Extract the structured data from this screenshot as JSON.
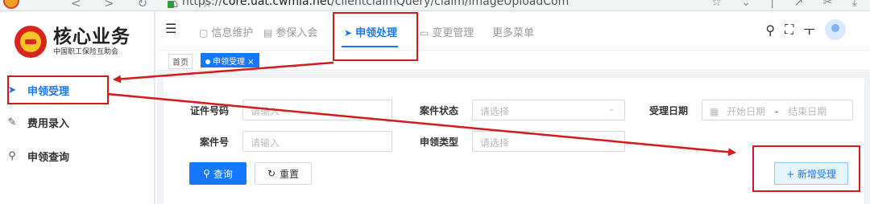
{
  "browser": {
    "url_prefix": "https://",
    "url_host": "core.uat.cwmia.net",
    "url_path": "/clientclaimQuery/claim/imageUploadCom"
  },
  "sidebar": {
    "logo_title": "核心业务",
    "logo_subtitle": "中国职工保险互助会",
    "items": [
      {
        "label": "申领受理",
        "icon": "send-icon",
        "active": true
      },
      {
        "label": "费用录入",
        "icon": "edit-icon",
        "active": false
      },
      {
        "label": "申领查询",
        "icon": "search-icon",
        "active": false
      }
    ]
  },
  "topnav": {
    "items": [
      {
        "label": "信息维护",
        "icon": "document-icon"
      },
      {
        "label": "参保入会",
        "icon": "form-icon"
      },
      {
        "label": "申领处理",
        "icon": "send-icon",
        "active": true
      },
      {
        "label": "变更管理",
        "icon": "monitor-icon"
      },
      {
        "label": "更多菜单",
        "icon": ""
      }
    ]
  },
  "tabs": {
    "home": "首页",
    "active": "申领受理 ×"
  },
  "form": {
    "cert_no_label": "证件号码",
    "cert_no_placeholder": "请输入",
    "case_status_label": "案件状态",
    "case_status_placeholder": "请选择",
    "accept_date_label": "受理日期",
    "start_date_placeholder": "开始日期",
    "date_sep": "-",
    "end_date_placeholder": "结束日期",
    "case_no_label": "案件号",
    "case_no_placeholder": "请输入",
    "claim_type_label": "申领类型",
    "claim_type_placeholder": "请选择"
  },
  "buttons": {
    "query": "查询",
    "reset": "重置",
    "add": "+ 新增受理"
  },
  "colors": {
    "primary": "#1677ff",
    "annotation": "#d6191b"
  }
}
